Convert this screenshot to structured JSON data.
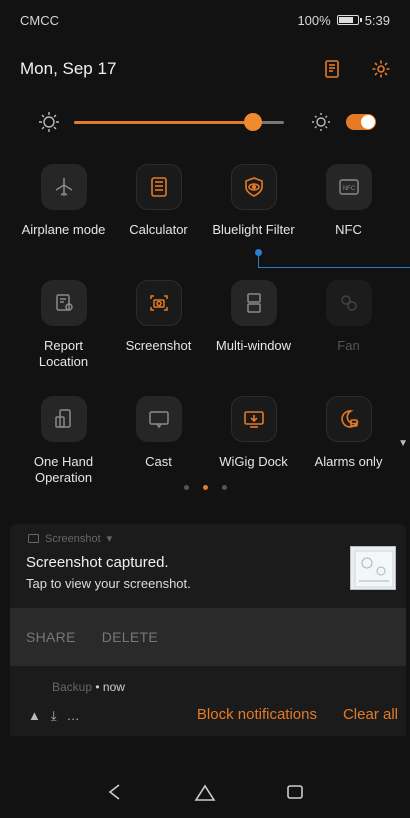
{
  "status": {
    "carrier": "CMCC",
    "battery": "100%",
    "time": "5:39"
  },
  "header": {
    "date": "Mon, Sep 17",
    "icons": [
      "edit-icon",
      "settings-icon"
    ]
  },
  "brightness": {
    "level": 0.85,
    "auto": true
  },
  "accent": "#e57a26",
  "tiles": [
    {
      "label": "Airplane mode",
      "icon": "airplane-icon",
      "on": false
    },
    {
      "label": "Calculator",
      "icon": "calculator-icon",
      "on": true
    },
    {
      "label": "Bluelight Filter",
      "icon": "eye-shield-icon",
      "on": true
    },
    {
      "label": "NFC",
      "icon": "nfc-icon",
      "on": false
    },
    {
      "label": "Report Location",
      "icon": "report-location-icon",
      "on": false
    },
    {
      "label": "Screenshot",
      "icon": "screenshot-icon",
      "on": true
    },
    {
      "label": "Multi-window",
      "icon": "multi-window-icon",
      "on": false
    },
    {
      "label": "Fan",
      "icon": "fan-icon",
      "on": false,
      "disabled": true
    },
    {
      "label": "One Hand Operation",
      "icon": "one-hand-icon",
      "on": false
    },
    {
      "label": "Cast",
      "icon": "cast-icon",
      "on": false
    },
    {
      "label": "WiGig Dock",
      "icon": "wigig-dock-icon",
      "on": true
    },
    {
      "label": "Alarms only",
      "icon": "alarm-moon-icon",
      "on": true
    }
  ],
  "pager": {
    "pages": 3,
    "active": 1
  },
  "notification": {
    "app": "Screenshot",
    "title": "Screenshot captured.",
    "text": "Tap to view your screenshot.",
    "actions": [
      "SHARE",
      "DELETE"
    ]
  },
  "backup": {
    "app": "Backup",
    "time": "• now",
    "block_label": "Block notifications",
    "clear_label": "Clear all"
  }
}
